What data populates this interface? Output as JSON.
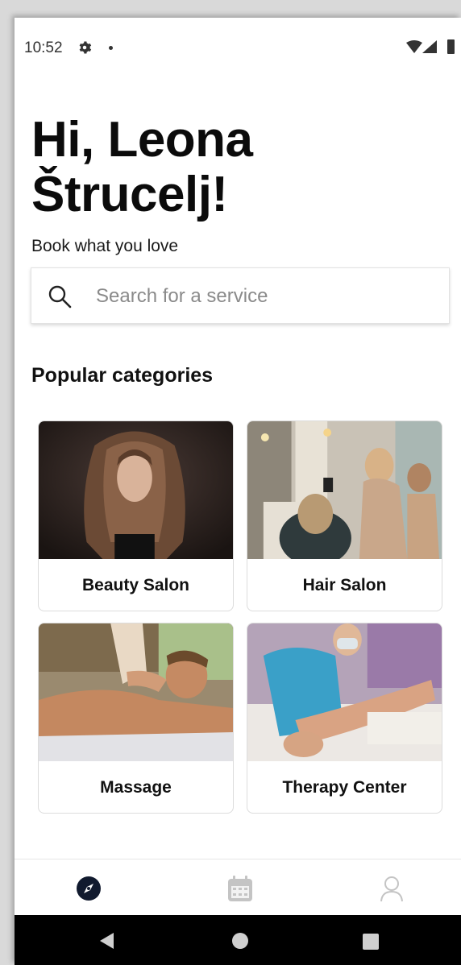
{
  "status_bar": {
    "time": "10:52",
    "icons": [
      "gear-icon",
      "notification-dot",
      "wifi-icon",
      "signal-icon",
      "battery-icon"
    ]
  },
  "header": {
    "greeting": "Hi, Leona Štrucelj!",
    "subtitle": "Book what you love"
  },
  "search": {
    "placeholder": "Search for a service",
    "value": ""
  },
  "popular": {
    "title": "Popular categories",
    "categories": [
      {
        "label": "Beauty Salon"
      },
      {
        "label": "Hair Salon"
      },
      {
        "label": "Massage"
      },
      {
        "label": "Therapy Center"
      }
    ]
  },
  "bottom_nav": {
    "items": [
      {
        "icon": "compass-icon",
        "active": true
      },
      {
        "icon": "calendar-icon",
        "active": false
      },
      {
        "icon": "profile-icon",
        "active": false
      }
    ],
    "active_color": "#111a2e",
    "inactive_color": "#c4c4c4"
  },
  "system_nav": {
    "buttons": [
      "back-button",
      "home-button",
      "recents-button"
    ]
  }
}
